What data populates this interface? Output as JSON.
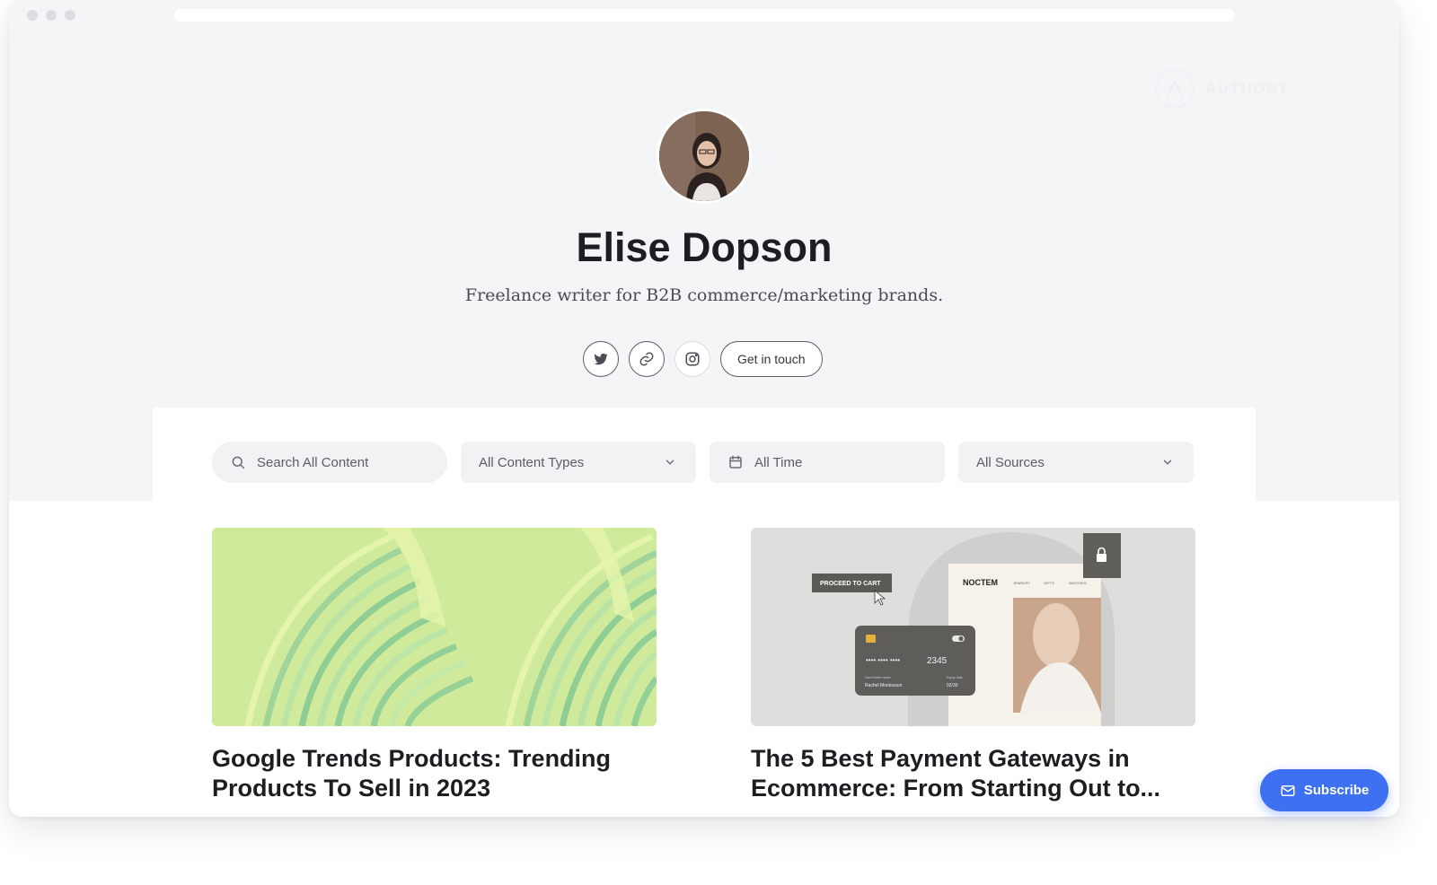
{
  "browser": {
    "traffic_lights": [
      "close",
      "minimize",
      "maximize"
    ]
  },
  "brand": {
    "logo_text": "AUTHORY",
    "icon": "authory-logo-icon"
  },
  "profile": {
    "name": "Elise Dopson",
    "bio": "Freelance writer for B2B commerce/marketing brands.",
    "avatar_icon": "avatar-photo"
  },
  "socials": {
    "items": [
      {
        "icon": "twitter-icon"
      },
      {
        "icon": "link-icon"
      },
      {
        "icon": "instagram-icon"
      }
    ],
    "contact_label": "Get in touch"
  },
  "filters": {
    "search_placeholder": "Search All Content",
    "content_types": "All Content Types",
    "time": "All Time",
    "sources": "All Sources"
  },
  "articles": [
    {
      "title": "Google Trends Products: Trending Products To Sell in 2023",
      "image_colors": [
        "#d0ea9b",
        "#e3f3a6",
        "#8fcf95",
        "#b6e2a3"
      ]
    },
    {
      "title": "The 5 Best Payment Gateways in Ecommerce: From Starting Out to...",
      "image_text": {
        "cart_button": "PROCEED TO CART",
        "store": "NOCTEM",
        "nav": [
          "JEWELRY",
          "GIFTS",
          "WATCHES"
        ],
        "card_number_dots": "•••• •••• ••••",
        "card_number_end": "2345",
        "holder_label": "Card Holder name",
        "holder_name": "Rachel Montessori",
        "expiry_label": "Expiry Date",
        "expiry": "02/30"
      }
    }
  ],
  "subscribe": {
    "label": "Subscribe",
    "color": "#3d71f2"
  },
  "colors": {
    "hero_bg": "#f4f5f7",
    "text": "#1d1e22"
  }
}
